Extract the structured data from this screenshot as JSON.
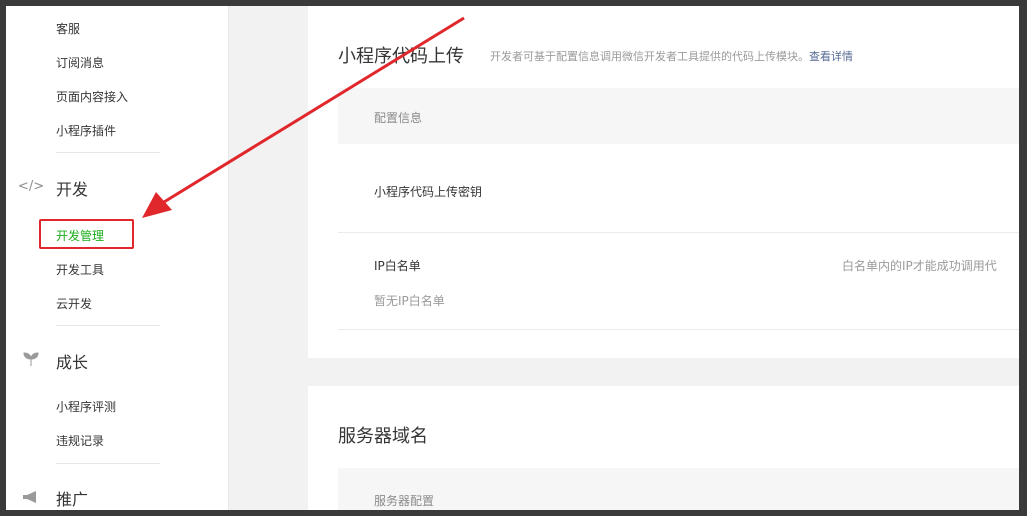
{
  "sidebar": {
    "top_items": [
      "客服",
      "订阅消息",
      "页面内容接入",
      "小程序插件"
    ],
    "dev_group": {
      "title": "开发",
      "icon": "code-icon",
      "items": [
        "开发管理",
        "开发工具",
        "云开发"
      ],
      "active": "开发管理"
    },
    "growth_group": {
      "title": "成长",
      "icon": "sprout-icon",
      "items": [
        "小程序评测",
        "违规记录"
      ]
    },
    "promo_group": {
      "title": "推广",
      "icon": "megaphone-icon"
    }
  },
  "upload_card": {
    "title": "小程序代码上传",
    "desc": "开发者可基于配置信息调用微信开发者工具提供的代码上传模块。",
    "link": "查看详情",
    "section_header": "配置信息",
    "key_label": "小程序代码上传密钥",
    "ip_label": "IP白名单",
    "ip_hint": "白名单内的IP才能成功调用代",
    "ip_empty": "暂无IP白名单"
  },
  "server_card": {
    "title": "服务器域名",
    "section_header": "服务器配置"
  },
  "colors": {
    "accent": "#1aad19",
    "link": "#576b95",
    "annotation": "#e0272b"
  }
}
